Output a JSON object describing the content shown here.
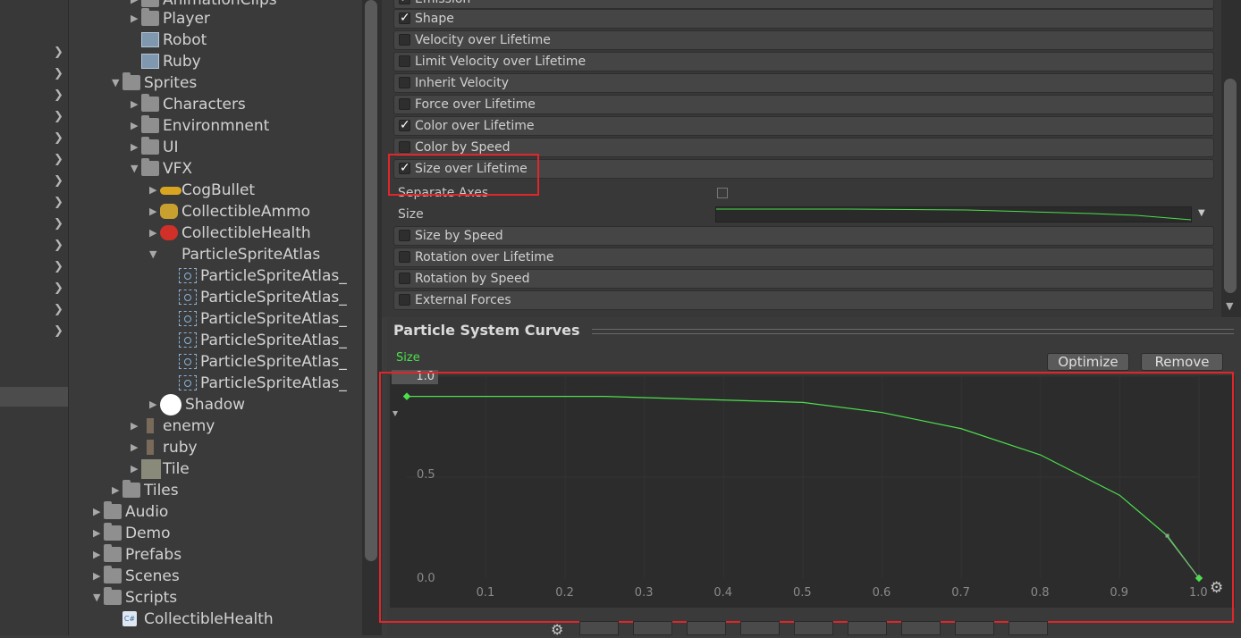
{
  "project_tree": {
    "rows": [
      {
        "label": "AnimationClips",
        "icon": "folder-icon"
      },
      {
        "label": "Player",
        "icon": "folder-icon"
      },
      {
        "label": "Robot",
        "icon": "prefab-icon"
      },
      {
        "label": "Ruby",
        "icon": "prefab-icon"
      },
      {
        "label": "Sprites",
        "icon": "folder-icon"
      },
      {
        "label": "Characters",
        "icon": "folder-icon"
      },
      {
        "label": "Environmnent",
        "icon": "folder-icon"
      },
      {
        "label": "UI",
        "icon": "folder-icon"
      },
      {
        "label": "VFX",
        "icon": "folder-icon"
      },
      {
        "label": "CogBullet",
        "icon": "cog-bullet-icon"
      },
      {
        "label": "CollectibleAmmo",
        "icon": "ammo-icon"
      },
      {
        "label": "CollectibleHealth",
        "icon": "health-icon"
      },
      {
        "label": "ParticleSpriteAtlas",
        "icon": "particle-atlas-icon"
      },
      {
        "label": "ParticleSpriteAtlas_",
        "icon": "sprite-icon"
      },
      {
        "label": "ParticleSpriteAtlas_",
        "icon": "sprite-icon"
      },
      {
        "label": "ParticleSpriteAtlas_",
        "icon": "sprite-icon"
      },
      {
        "label": "ParticleSpriteAtlas_",
        "icon": "sprite-icon"
      },
      {
        "label": "ParticleSpriteAtlas_",
        "icon": "sprite-icon"
      },
      {
        "label": "ParticleSpriteAtlas_",
        "icon": "sprite-icon"
      },
      {
        "label": "Shadow",
        "icon": "shadow-icon"
      },
      {
        "label": "enemy",
        "icon": "enemy-icon"
      },
      {
        "label": "ruby",
        "icon": "ruby-icon"
      },
      {
        "label": "Tile",
        "icon": "tile-icon"
      },
      {
        "label": "Tiles",
        "icon": "folder-icon"
      },
      {
        "label": "Audio",
        "icon": "folder-icon"
      },
      {
        "label": "Demo",
        "icon": "folder-icon"
      },
      {
        "label": "Prefabs",
        "icon": "folder-icon"
      },
      {
        "label": "Scenes",
        "icon": "folder-icon"
      },
      {
        "label": "Scripts",
        "icon": "folder-icon"
      },
      {
        "label": "CollectibleHealth",
        "icon": "csharp-script-icon"
      }
    ]
  },
  "inspector": {
    "modules": [
      {
        "label": "Emission",
        "checked": true
      },
      {
        "label": "Shape",
        "checked": true
      },
      {
        "label": "Velocity over Lifetime",
        "checked": false
      },
      {
        "label": "Limit Velocity over Lifetime",
        "checked": false
      },
      {
        "label": "Inherit Velocity",
        "checked": false
      },
      {
        "label": "Force over Lifetime",
        "checked": false
      },
      {
        "label": "Color over Lifetime",
        "checked": true
      },
      {
        "label": "Color by Speed",
        "checked": false
      },
      {
        "label": "Size over Lifetime",
        "checked": true
      },
      {
        "label": "Size by Speed",
        "checked": false
      },
      {
        "label": "Rotation over Lifetime",
        "checked": false
      },
      {
        "label": "Rotation by Speed",
        "checked": false
      },
      {
        "label": "External Forces",
        "checked": false
      }
    ],
    "size_over_lifetime": {
      "separate_axes_label": "Separate Axes",
      "size_label": "Size"
    }
  },
  "curves_panel": {
    "title": "Particle System Curves",
    "legend": "Size",
    "legend_color": "#4ce04c",
    "optimize_label": "Optimize",
    "remove_label": "Remove",
    "y_max_field": "1.0",
    "y_ticks": [
      "0.5",
      "0.0"
    ],
    "x_ticks": [
      "0.1",
      "0.2",
      "0.3",
      "0.4",
      "0.5",
      "0.6",
      "0.7",
      "0.8",
      "0.9",
      "1.0"
    ]
  },
  "chart_data": {
    "type": "line",
    "title": "",
    "xlabel": "",
    "ylabel": "",
    "xlim": [
      0.0,
      1.05
    ],
    "ylim": [
      0.0,
      1.0
    ],
    "grid": true,
    "series": [
      {
        "name": "Size",
        "color": "#4ce04c",
        "x": [
          0.0,
          0.25,
          0.5,
          0.6,
          0.7,
          0.8,
          0.9,
          0.96,
          1.0
        ],
        "y": [
          0.9,
          0.9,
          0.87,
          0.82,
          0.74,
          0.61,
          0.41,
          0.21,
          0.0
        ]
      }
    ]
  },
  "accent_colors": {
    "highlight_box": "#e0262a",
    "curve": "#4ce04c"
  }
}
